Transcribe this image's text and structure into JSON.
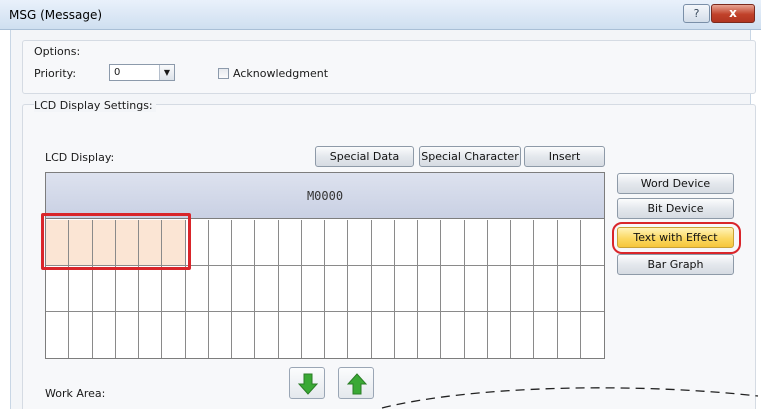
{
  "window": {
    "title": "MSG (Message)",
    "help_label": "?",
    "close_label": "x"
  },
  "options": {
    "group_label": "Options:",
    "priority_label": "Priority:",
    "priority_value": "0",
    "acknowledgment_label": "Acknowledgment"
  },
  "lcd_settings": {
    "group_label": "LCD Display Settings:",
    "lcd_display_label": "LCD Display:",
    "buttons": {
      "special_data": "Special Data",
      "special_character": "Special Character",
      "insert": "Insert"
    },
    "header_text": "M0000",
    "side_buttons": {
      "word_device": "Word Device",
      "bit_device": "Bit Device",
      "text_with_effect": "Text with Effect",
      "bar_graph": "Bar Graph"
    },
    "work_area_label": "Work Area:",
    "move_down_icon": "green-down-arrow-icon",
    "move_up_icon": "green-up-arrow-icon"
  },
  "colors": {
    "highlight_button": "#f6c63c",
    "annotation_red": "#d9252a",
    "selected_cell": "#fbe5d4",
    "arrow_green": "#3aa935"
  }
}
